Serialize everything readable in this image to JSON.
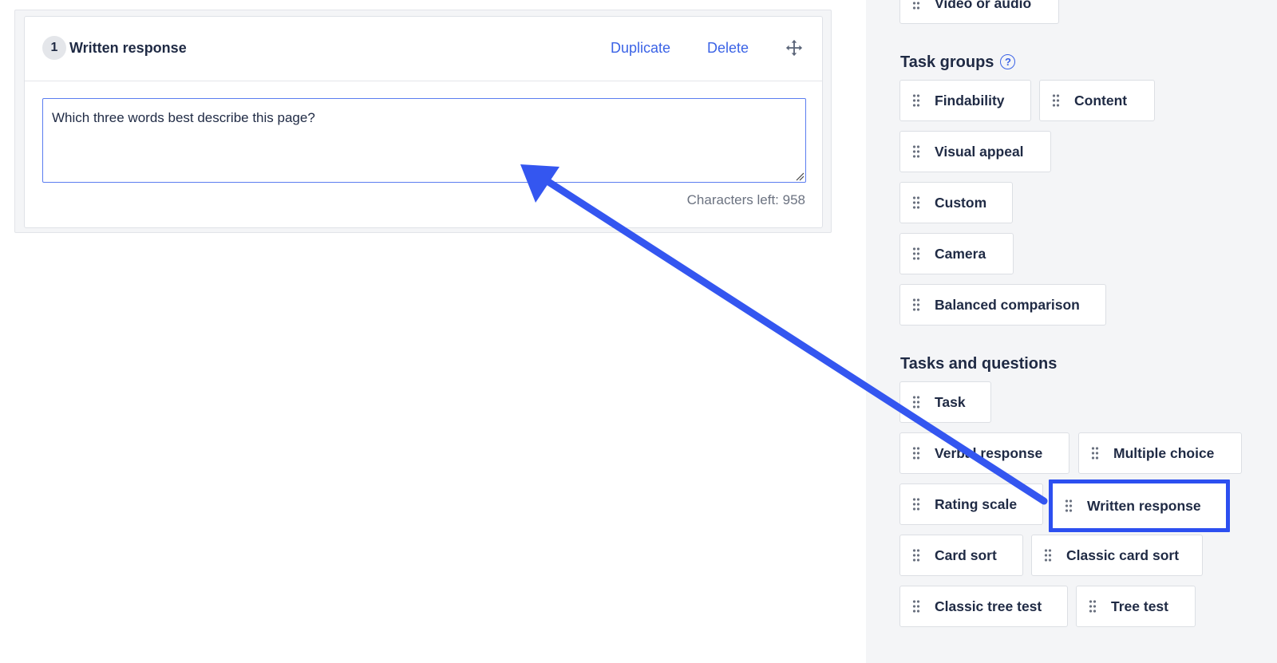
{
  "editor": {
    "question_number": "1",
    "question_title": "Written response",
    "duplicate_label": "Duplicate",
    "delete_label": "Delete",
    "textarea_value": "Which three words best describe this page?",
    "chars_left": "Characters left: 958"
  },
  "palette": {
    "top_item": "Video or audio",
    "task_groups": {
      "title": "Task groups",
      "help_glyph": "?",
      "items": [
        "Findability",
        "Content",
        "Visual appeal",
        "Custom",
        "Camera",
        "Balanced comparison"
      ]
    },
    "tasks_and_questions": {
      "title": "Tasks and questions",
      "items": [
        "Task",
        "Verbal response",
        "Multiple choice",
        "Rating scale",
        "Written response",
        "Card sort",
        "Classic card sort",
        "Classic tree test",
        "Tree test"
      ],
      "highlighted": "Written response"
    }
  },
  "colors": {
    "accent": "#3b63e6",
    "annotation_arrow": "#3456f0",
    "sidebar_bg": "#f4f5f7"
  },
  "icons": {
    "move": "move-arrows-icon",
    "drag": "drag-handle-icon",
    "help": "help-circle-icon"
  }
}
